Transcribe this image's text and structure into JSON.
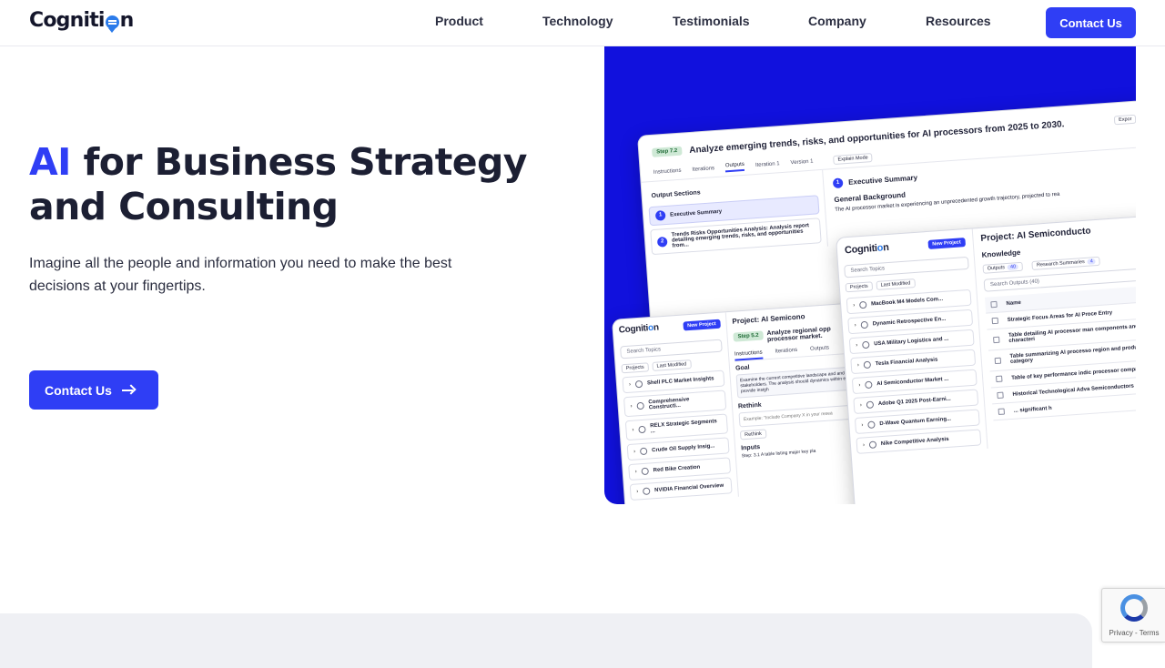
{
  "header": {
    "logo_text_pre": "Cogniti",
    "logo_text_post": "n",
    "nav": [
      "Product",
      "Technology",
      "Testimonials",
      "Company",
      "Resources"
    ],
    "contact_label": "Contact Us"
  },
  "hero": {
    "title_accent": "AI",
    "title_rest_line1": " for Business Strategy",
    "title_line2": "and Consulting",
    "subtitle": "Imagine all the people and information you need to make the best decisions at your fingertips.",
    "cta_label": "Contact Us"
  },
  "preview": {
    "back": {
      "step": "Step 7.2",
      "title": "Analyze emerging trends, risks, and opportunities for AI processors from 2025 to 2030.",
      "export": "Expor",
      "tabs": [
        "Instructions",
        "Iterations",
        "Outputs",
        "Iteration 1",
        "Version 1"
      ],
      "explain_mode": "Explain Mode",
      "output_sections_label": "Output Sections",
      "sections": [
        {
          "num": "1",
          "label": "Executive Summary"
        },
        {
          "num": "2",
          "label": "Trends Risks Opportunities Analysis: Analysis report detailing emerging trends, risks, and opportunities from..."
        }
      ],
      "exec_summary_heading": "Executive Summary",
      "general_background": "General Background",
      "body_text": "The AI processor market is experiencing an unprecedented growth trajectory, projected to rea"
    },
    "front_left": {
      "logo_pre": "Cogniti",
      "logo_post": "n",
      "new_project": "New Project",
      "project_title": "Project: AI Semicono",
      "step": "Step 5.2",
      "step_title": "Analyze regional opp processor market.",
      "search": "Search Topics",
      "chips": [
        "Projects",
        "Last Modified"
      ],
      "items": [
        "Shell PLC Market Insights",
        "Comprehensive Constructi...",
        "RELX Strategic Segments ...",
        "Crude Oil Supply Insig...",
        "Red Bike Creation",
        "NVIDIA Financial Overview"
      ],
      "tabs": [
        "Instructions",
        "Iterations",
        "Outputs"
      ],
      "goal": "Goal",
      "goal_text": "Examine the current competitive landscape and and threats to stakeholders. The analysis should dynamics within each region and provide insigh",
      "rethink": "Rethink",
      "rethink_placeholder": "Example: \"Include Company X in your resea",
      "rethink_btn": "Rethink",
      "inputs": "Inputs",
      "input_item": "Step: 3.1 A table listing major key pla"
    },
    "front_right": {
      "logo_pre": "Cogniti",
      "logo_post": "n",
      "new_project": "New Project",
      "project_title": "Project: AI Semiconducto",
      "search": "Search Topics",
      "chips": [
        "Projects",
        "Last Modified"
      ],
      "items": [
        "MacBook M4 Models Com...",
        "Dynamic Retrospective En...",
        "USA Military Logistics and ...",
        "Tesla Financial Analysis",
        "AI Semiconductor Market ...",
        "Adobe Q1 2025 Post-Earni...",
        "D-Wave Quantum Earning...",
        "Nike Competitive Analysis"
      ],
      "knowledge": "Knowledge",
      "outputs_tab": "Outputs",
      "outputs_count": "40",
      "research_tab": "Research Summaries",
      "research_count": "4",
      "search_outputs": "Search Outputs (40)",
      "name_col": "Name",
      "rows": [
        "Strategic Focus Areas for AI Proce Entry",
        "Table detailing AI processor man components and their characteri",
        "Table summarizing AI processo region and product category",
        "Table of key performance indic processor companies",
        "Historical Technological Adva Semiconductors",
        "... significant h"
      ]
    }
  },
  "recaptcha": {
    "text": "Privacy - Terms"
  },
  "colors": {
    "accent": "#2f3ef5",
    "panel": "#1111dd",
    "text": "#1c1f33"
  }
}
